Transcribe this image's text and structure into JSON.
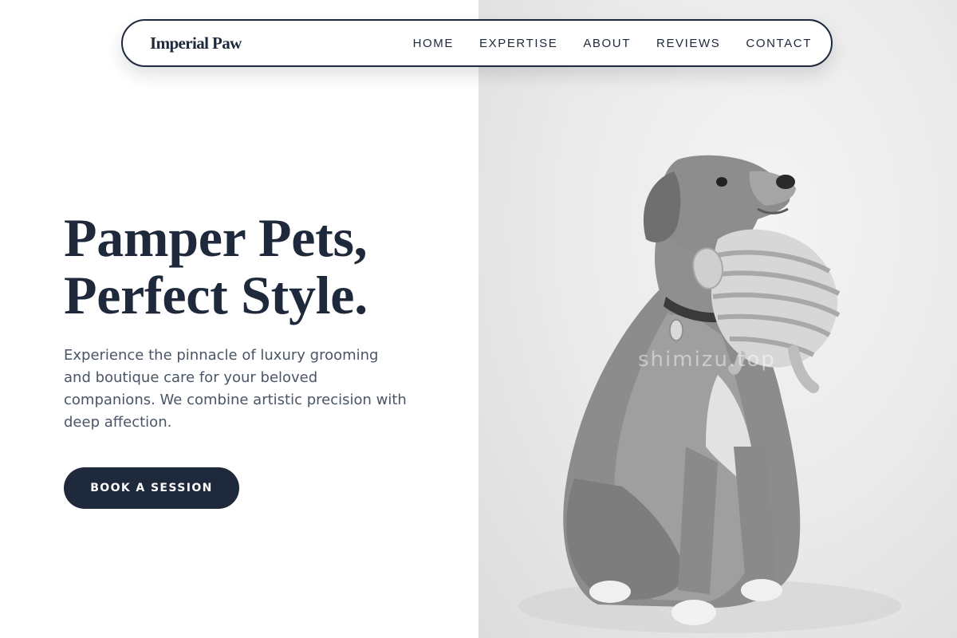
{
  "nav": {
    "brand": "Imperial Paw",
    "links": [
      {
        "label": "HOME"
      },
      {
        "label": "EXPERTISE"
      },
      {
        "label": "ABOUT"
      },
      {
        "label": "REVIEWS"
      },
      {
        "label": "CONTACT"
      }
    ]
  },
  "hero": {
    "title_line1": "Pamper Pets,",
    "title_line2": "Perfect Style.",
    "description": "Experience the pinnacle of luxury grooming and boutique care for your beloved companions. We combine artistic precision with deep affection.",
    "cta_label": "BOOK A SESSION"
  },
  "photo": {
    "subject": "dog-holding-toy-photo",
    "watermark_text": "shimizu.top"
  },
  "colors": {
    "primary": "#1e293b",
    "body_text": "#4a5566",
    "background": "#ffffff",
    "photo_background": "#e9e9e9"
  }
}
